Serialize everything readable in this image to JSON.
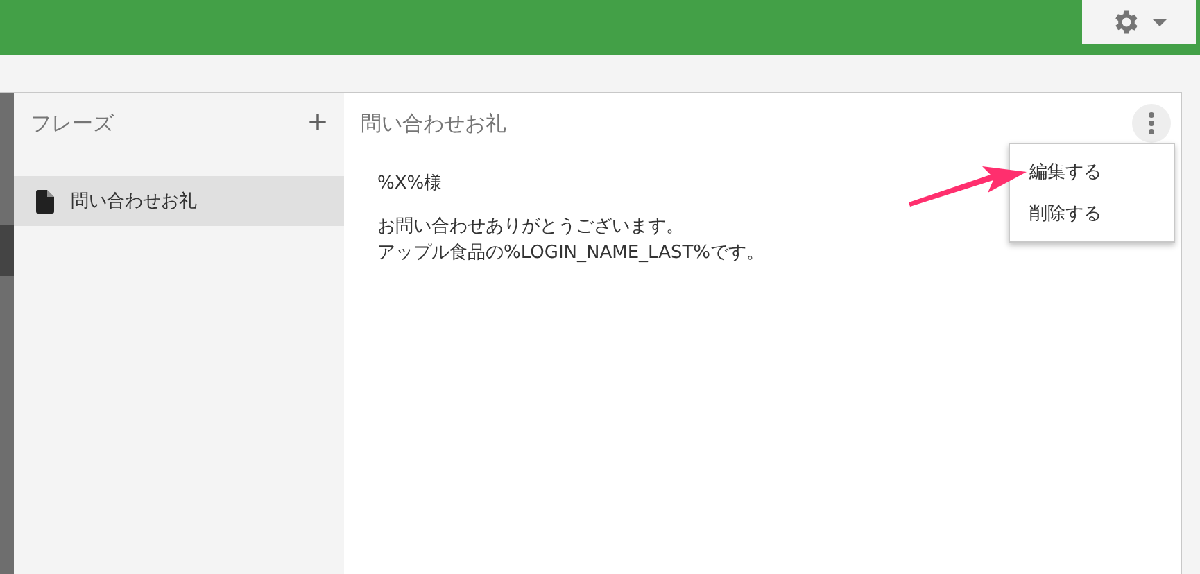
{
  "header": {
    "settings_menu": {
      "expanded": false
    }
  },
  "sidebar": {
    "title": "フレーズ",
    "add_label": "+",
    "items": [
      {
        "label": "問い合わせお礼",
        "selected": true
      }
    ]
  },
  "content": {
    "title": "問い合わせお礼",
    "body": [
      [
        "%X%様"
      ],
      [
        "お問い合わせありがとうございます。",
        "アップル食品の%LOGIN_NAME_LAST%です。"
      ]
    ],
    "menu": {
      "open": true,
      "items": [
        {
          "label": "編集する"
        },
        {
          "label": "削除する"
        }
      ]
    }
  }
}
